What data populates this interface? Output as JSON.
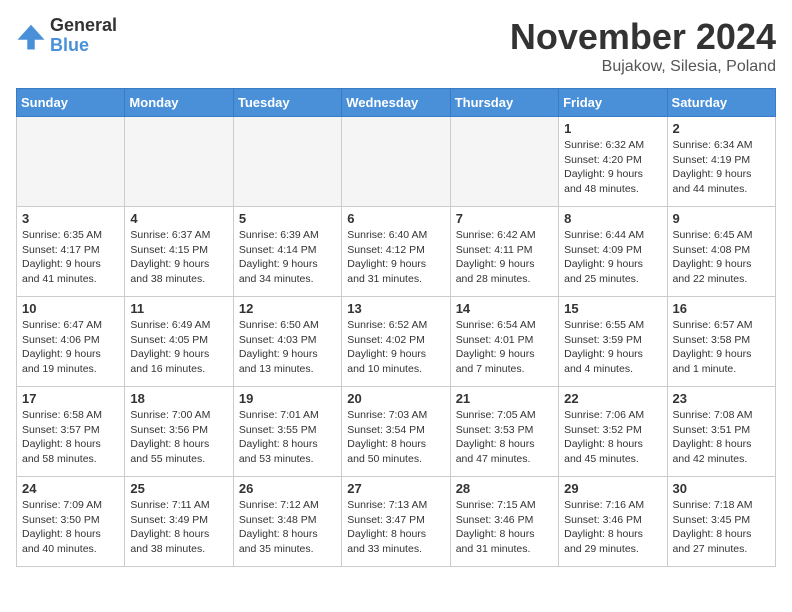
{
  "logo": {
    "general": "General",
    "blue": "Blue"
  },
  "title": "November 2024",
  "location": "Bujakow, Silesia, Poland",
  "weekdays": [
    "Sunday",
    "Monday",
    "Tuesday",
    "Wednesday",
    "Thursday",
    "Friday",
    "Saturday"
  ],
  "weeks": [
    [
      {
        "day": "",
        "info": ""
      },
      {
        "day": "",
        "info": ""
      },
      {
        "day": "",
        "info": ""
      },
      {
        "day": "",
        "info": ""
      },
      {
        "day": "",
        "info": ""
      },
      {
        "day": "1",
        "info": "Sunrise: 6:32 AM\nSunset: 4:20 PM\nDaylight: 9 hours and 48 minutes."
      },
      {
        "day": "2",
        "info": "Sunrise: 6:34 AM\nSunset: 4:19 PM\nDaylight: 9 hours and 44 minutes."
      }
    ],
    [
      {
        "day": "3",
        "info": "Sunrise: 6:35 AM\nSunset: 4:17 PM\nDaylight: 9 hours and 41 minutes."
      },
      {
        "day": "4",
        "info": "Sunrise: 6:37 AM\nSunset: 4:15 PM\nDaylight: 9 hours and 38 minutes."
      },
      {
        "day": "5",
        "info": "Sunrise: 6:39 AM\nSunset: 4:14 PM\nDaylight: 9 hours and 34 minutes."
      },
      {
        "day": "6",
        "info": "Sunrise: 6:40 AM\nSunset: 4:12 PM\nDaylight: 9 hours and 31 minutes."
      },
      {
        "day": "7",
        "info": "Sunrise: 6:42 AM\nSunset: 4:11 PM\nDaylight: 9 hours and 28 minutes."
      },
      {
        "day": "8",
        "info": "Sunrise: 6:44 AM\nSunset: 4:09 PM\nDaylight: 9 hours and 25 minutes."
      },
      {
        "day": "9",
        "info": "Sunrise: 6:45 AM\nSunset: 4:08 PM\nDaylight: 9 hours and 22 minutes."
      }
    ],
    [
      {
        "day": "10",
        "info": "Sunrise: 6:47 AM\nSunset: 4:06 PM\nDaylight: 9 hours and 19 minutes."
      },
      {
        "day": "11",
        "info": "Sunrise: 6:49 AM\nSunset: 4:05 PM\nDaylight: 9 hours and 16 minutes."
      },
      {
        "day": "12",
        "info": "Sunrise: 6:50 AM\nSunset: 4:03 PM\nDaylight: 9 hours and 13 minutes."
      },
      {
        "day": "13",
        "info": "Sunrise: 6:52 AM\nSunset: 4:02 PM\nDaylight: 9 hours and 10 minutes."
      },
      {
        "day": "14",
        "info": "Sunrise: 6:54 AM\nSunset: 4:01 PM\nDaylight: 9 hours and 7 minutes."
      },
      {
        "day": "15",
        "info": "Sunrise: 6:55 AM\nSunset: 3:59 PM\nDaylight: 9 hours and 4 minutes."
      },
      {
        "day": "16",
        "info": "Sunrise: 6:57 AM\nSunset: 3:58 PM\nDaylight: 9 hours and 1 minute."
      }
    ],
    [
      {
        "day": "17",
        "info": "Sunrise: 6:58 AM\nSunset: 3:57 PM\nDaylight: 8 hours and 58 minutes."
      },
      {
        "day": "18",
        "info": "Sunrise: 7:00 AM\nSunset: 3:56 PM\nDaylight: 8 hours and 55 minutes."
      },
      {
        "day": "19",
        "info": "Sunrise: 7:01 AM\nSunset: 3:55 PM\nDaylight: 8 hours and 53 minutes."
      },
      {
        "day": "20",
        "info": "Sunrise: 7:03 AM\nSunset: 3:54 PM\nDaylight: 8 hours and 50 minutes."
      },
      {
        "day": "21",
        "info": "Sunrise: 7:05 AM\nSunset: 3:53 PM\nDaylight: 8 hours and 47 minutes."
      },
      {
        "day": "22",
        "info": "Sunrise: 7:06 AM\nSunset: 3:52 PM\nDaylight: 8 hours and 45 minutes."
      },
      {
        "day": "23",
        "info": "Sunrise: 7:08 AM\nSunset: 3:51 PM\nDaylight: 8 hours and 42 minutes."
      }
    ],
    [
      {
        "day": "24",
        "info": "Sunrise: 7:09 AM\nSunset: 3:50 PM\nDaylight: 8 hours and 40 minutes."
      },
      {
        "day": "25",
        "info": "Sunrise: 7:11 AM\nSunset: 3:49 PM\nDaylight: 8 hours and 38 minutes."
      },
      {
        "day": "26",
        "info": "Sunrise: 7:12 AM\nSunset: 3:48 PM\nDaylight: 8 hours and 35 minutes."
      },
      {
        "day": "27",
        "info": "Sunrise: 7:13 AM\nSunset: 3:47 PM\nDaylight: 8 hours and 33 minutes."
      },
      {
        "day": "28",
        "info": "Sunrise: 7:15 AM\nSunset: 3:46 PM\nDaylight: 8 hours and 31 minutes."
      },
      {
        "day": "29",
        "info": "Sunrise: 7:16 AM\nSunset: 3:46 PM\nDaylight: 8 hours and 29 minutes."
      },
      {
        "day": "30",
        "info": "Sunrise: 7:18 AM\nSunset: 3:45 PM\nDaylight: 8 hours and 27 minutes."
      }
    ]
  ]
}
